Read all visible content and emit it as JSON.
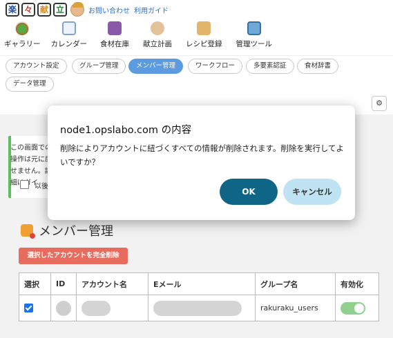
{
  "logo": {
    "chars": [
      "楽",
      "々",
      "献",
      "立"
    ]
  },
  "header": {
    "links": [
      "お問い合わせ",
      "利用ガイド"
    ],
    "nav": [
      {
        "label": "ギャラリー",
        "icon": "gallery-icon"
      },
      {
        "label": "カレンダー",
        "icon": "calendar-icon"
      },
      {
        "label": "食材在庫",
        "icon": "stock-icon"
      },
      {
        "label": "献立計画",
        "icon": "plan-icon"
      },
      {
        "label": "レシピ登録",
        "icon": "recipe-icon"
      },
      {
        "label": "管理ツール",
        "icon": "admin-tool-icon"
      }
    ]
  },
  "tabs": [
    {
      "label": "アカウント設定"
    },
    {
      "label": "グループ管理"
    },
    {
      "label": "メンバー管理",
      "active": true
    },
    {
      "label": "ワークフロー"
    },
    {
      "label": "多要素認証"
    },
    {
      "label": "食材辞書"
    },
    {
      "label": "データ管理"
    }
  ],
  "gear_symbol": "⚙",
  "info": {
    "text": "この画面での操作は元に戻せません。詳細はガイ",
    "check_label": "以後"
  },
  "page": {
    "title": "メンバー管理"
  },
  "delete_button": "選択したアカウントを完全削除",
  "table": {
    "headers": [
      "選択",
      "ID",
      "アカウント名",
      "Eメール",
      "グループ名",
      "有効化"
    ],
    "rows": [
      {
        "group": "rakuraku_users",
        "selected": true,
        "enabled": true
      }
    ]
  },
  "dialog": {
    "title": "node1.opslabo.com の内容",
    "message": "削除によりアカウントに紐づくすべての情報が削除されます。削除を実行してよいですか？",
    "ok": "OK",
    "cancel": "キャンセル"
  },
  "colors": {
    "accent": "#5d9be0",
    "danger": "#e86c5e",
    "ok_button": "#0e6586",
    "cancel_button": "#bfe3f2",
    "toggle_on": "#8fd08f",
    "info_border": "#5bbf5b"
  }
}
